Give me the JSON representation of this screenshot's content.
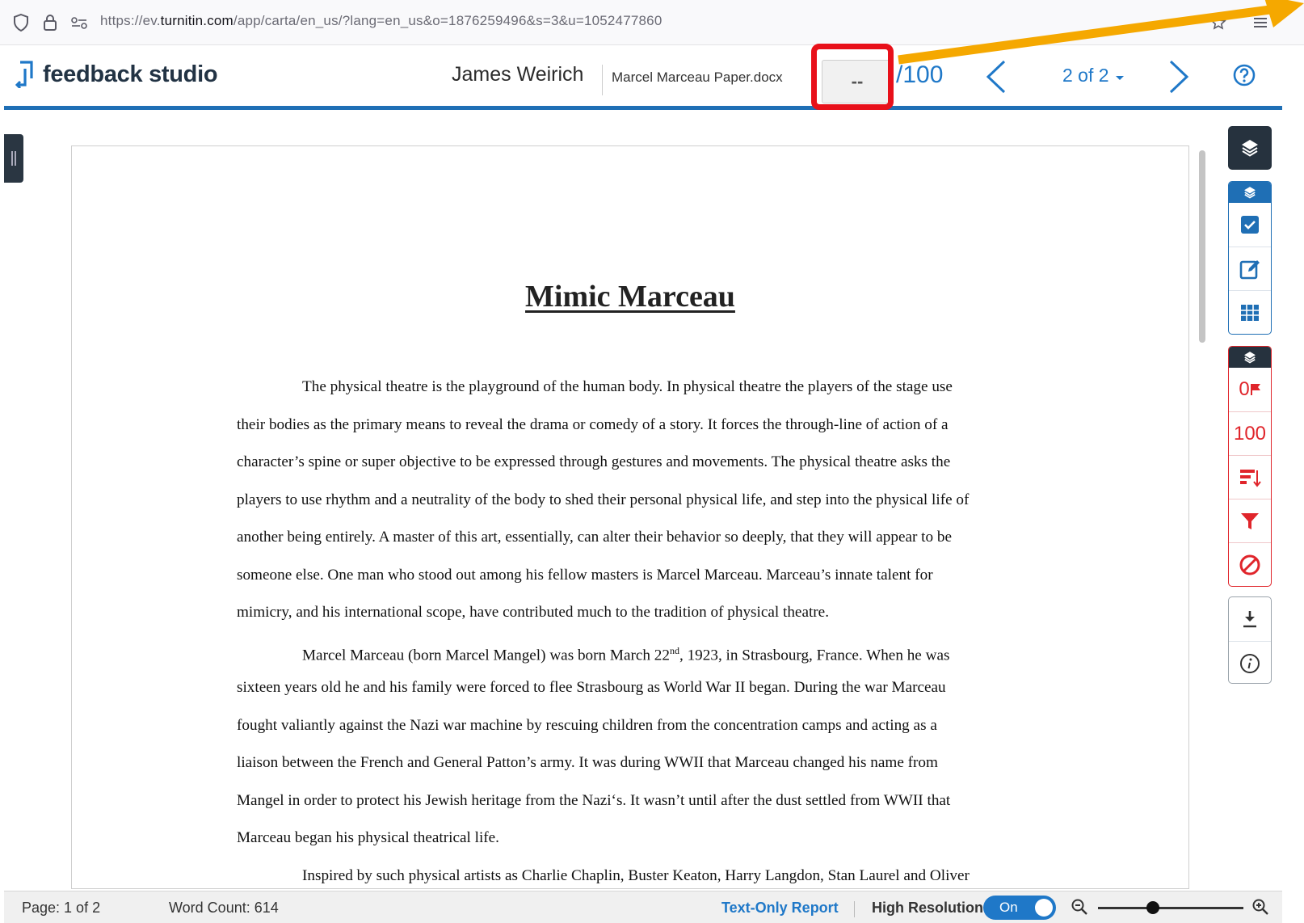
{
  "browser": {
    "url_prefix": "https://ev.",
    "url_host": "turnitin.com",
    "url_path": "/app/carta/en_us/?lang=en_us&o=1876259496&s=3&u=1052477860"
  },
  "header": {
    "logo_text": "feedback studio",
    "student_name": "James Weirich",
    "paper_name": "Marcel Marceau Paper.docx",
    "grade_value": "--",
    "grade_total": "/100",
    "page_indicator": "2 of 2"
  },
  "document": {
    "title": "Mimic Marceau",
    "lines": [
      {
        "text": "The physical theatre is the playground of the human body.   In physical theatre the players of the stage use"
      },
      {
        "text": "their bodies as the primary means to reveal the drama or comedy of a story.   It forces the through-line of action of a"
      },
      {
        "text": "character’s spine or super objective to be expressed through gestures and movements.   The physical theatre asks the"
      },
      {
        "text": "players to use rhythm and a neutrality of the body to shed their personal physical life, and step into the physical life of"
      },
      {
        "text": "another being entirely.   A master of this art, essentially, can alter their behavior so deeply, that they will appear to be"
      },
      {
        "text": "someone else.   One man who stood out among his fellow masters is Marcel Marceau.   Marceau’s innate talent for"
      },
      {
        "text": "mimicry, and his international scope, have contributed much to the tradition of physical theatre."
      },
      {
        "text_before": "Marcel Marceau (born Marcel Mangel) was born March 22",
        "sup": "nd",
        "text_after": ", 1923, in Strasbourg, France.   When he was"
      },
      {
        "text": "sixteen years old he and his family were forced to flee Strasbourg as World War II began.   During the war Marceau"
      },
      {
        "text": "fought valiantly against the Nazi war machine by rescuing children from the concentration camps and acting as a"
      },
      {
        "text": "liaison between the French and General Patton’s army.   It was during WWII that Marceau changed his name from"
      },
      {
        "text": "Mangel in order to protect his Jewish heritage from the Nazi‘s.   It wasn’t until after the dust settled from WWII that"
      },
      {
        "text": "Marceau began his physical theatrical life."
      },
      {
        "text": "Inspired by such physical artists as Charlie Chaplin, Buster Keaton, Harry Langdon, Stan Laurel and Oliver"
      }
    ]
  },
  "toolbar": {
    "flags_count": "0",
    "similarity_score": "100"
  },
  "statusbar": {
    "page": "Page: 1 of 2",
    "word_count": "Word Count: 614",
    "text_only_report": "Text-Only Report",
    "high_resolution": "High Resolution",
    "toggle_state": "On"
  },
  "colors": {
    "brand_blue": "#1f6fb5",
    "link_blue": "#1f78c8",
    "similarity_red": "#e0252b",
    "highlight_red": "#e8101a",
    "arrow_orange": "#f5a800"
  }
}
